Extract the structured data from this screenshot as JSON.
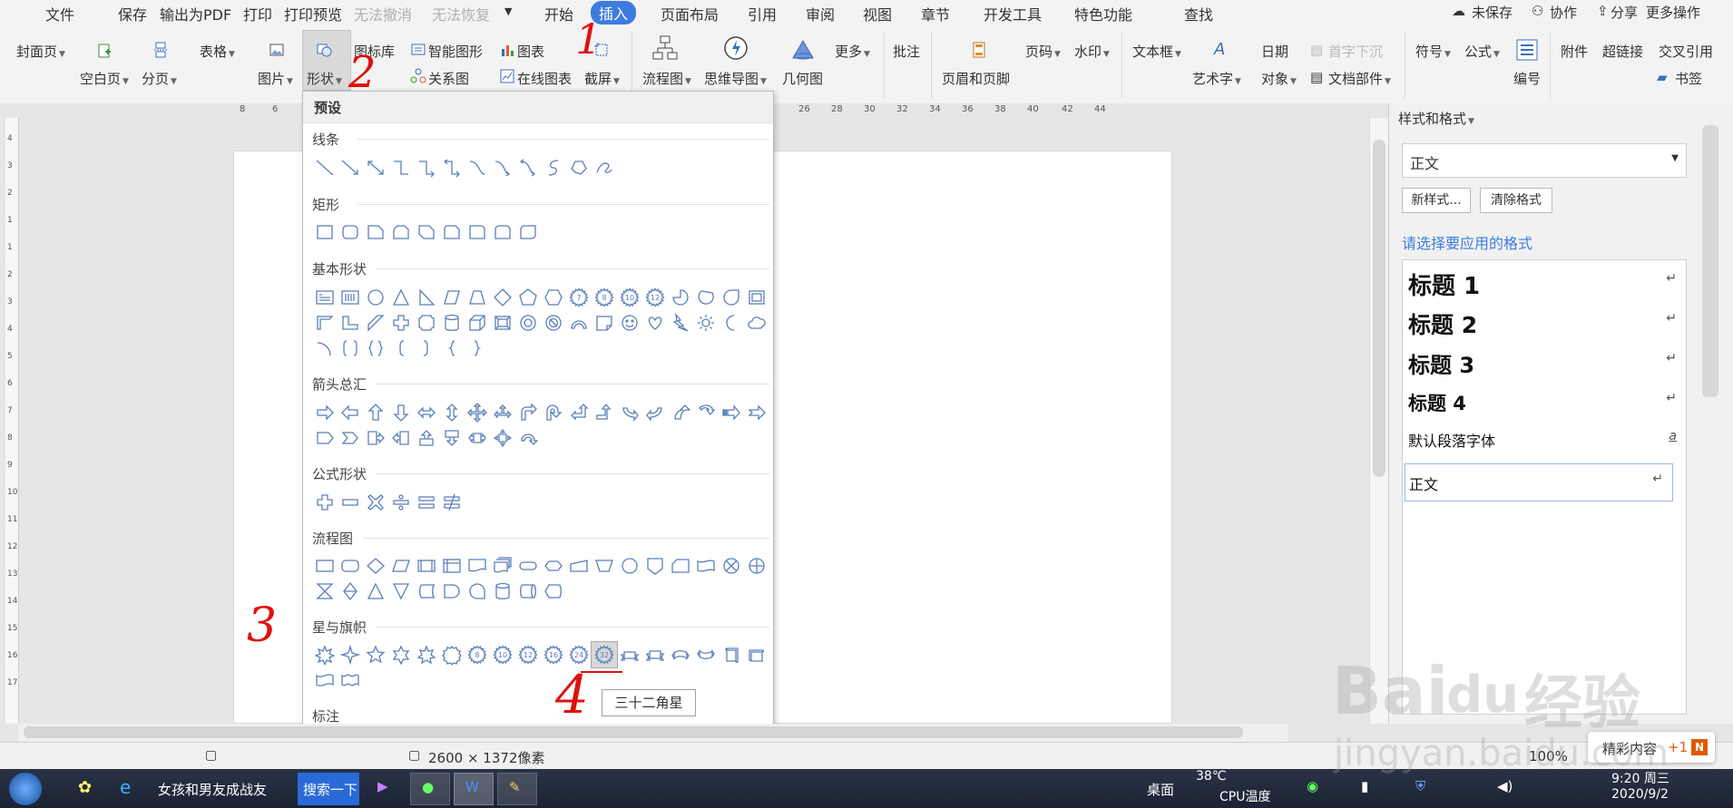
{
  "menu": {
    "file": "文件",
    "save": "保存",
    "export_pdf": "输出为PDF",
    "print": "打印",
    "print_preview": "打印预览",
    "undo": "无法撤消",
    "redo": "无法恢复",
    "tabs": [
      "开始",
      "插入",
      "页面布局",
      "引用",
      "审阅",
      "视图",
      "章节",
      "开发工具",
      "特色功能"
    ],
    "search": "查找",
    "unsaved": "未保存",
    "collab": "协作",
    "share": "分享",
    "more_ops": "更多操作"
  },
  "ribbon": {
    "cover": "封面页",
    "blank_page": "空白页",
    "page_break": "分页",
    "table": "表格",
    "picture": "图片",
    "shape": "形状",
    "icon_lib": "图标库",
    "smart_shape": "智能图形",
    "chart": "图表",
    "relation": "关系图",
    "online_chart": "在线图表",
    "screenshot": "截屏",
    "flowchart": "流程图",
    "mindmap": "思维导图",
    "geometry": "几何图",
    "more": "更多",
    "comment": "批注",
    "header_footer": "页眉和页脚",
    "page_num": "页码",
    "watermark": "水印",
    "textbox": "文本框",
    "wordart": "艺术字",
    "date": "日期",
    "object": "对象",
    "dropcap": "首字下沉",
    "doc_parts": "文档部件",
    "symbol": "符号",
    "formula": "公式",
    "numbering": "编号",
    "attachment": "附件",
    "hyperlink": "超链接",
    "crossref": "交叉引用",
    "bookmark": "书签"
  },
  "ruler": [
    "8",
    "6",
    "26",
    "28",
    "30",
    "32",
    "34",
    "36",
    "38",
    "40",
    "42",
    "44"
  ],
  "vruler": [
    "4",
    "3",
    "2",
    "1",
    "1",
    "2",
    "3",
    "4",
    "5",
    "6",
    "7",
    "8",
    "9",
    "10",
    "11",
    "12",
    "13",
    "14",
    "15",
    "16",
    "17"
  ],
  "shapes_panel": {
    "preset": "预设",
    "lines": "线条",
    "rects": "矩形",
    "basic": "基本形状",
    "arrows": "箭头总汇",
    "formula": "公式形状",
    "flow": "流程图",
    "stars": "星与旗帜",
    "callouts": "标注",
    "tooltip": "三十二角星",
    "basic_numbers": [
      "7",
      "8",
      "10",
      "12"
    ],
    "star_numbers": [
      "8",
      "10",
      "12",
      "16",
      "24",
      "32"
    ]
  },
  "right_panel": {
    "title": "样式和格式",
    "current_style": "正文",
    "new_style": "新样式...",
    "clear_format": "清除格式",
    "choose_prompt": "请选择要应用的格式",
    "styles": [
      "标题 1",
      "标题 2",
      "标题 3",
      "标题 4",
      "默认段落字体",
      "正文"
    ],
    "marks": [
      "↵",
      "↵",
      "↵",
      "↵",
      "a",
      "↵"
    ]
  },
  "status": {
    "size": "2600 × 1372像素",
    "zoom": "100%",
    "featured": "精彩内容",
    "plus": "+1"
  },
  "taskbar": {
    "window1": "女孩和男友成战友",
    "search": "搜索一下",
    "desktop": "桌面",
    "temp": "38℃",
    "cpu": "CPU温度",
    "time": "9:20 周三",
    "date": "2020/9/2"
  },
  "annotations": [
    "1",
    "2",
    "3",
    "4"
  ],
  "watermark": {
    "brand": "Bai",
    "du": "du",
    "jy": "经验",
    "url": "jingyan.baidu.com"
  },
  "colors": {
    "accent": "#3d7be0",
    "annotation": "#e01010",
    "shape_stroke": "#5a7fb8"
  }
}
